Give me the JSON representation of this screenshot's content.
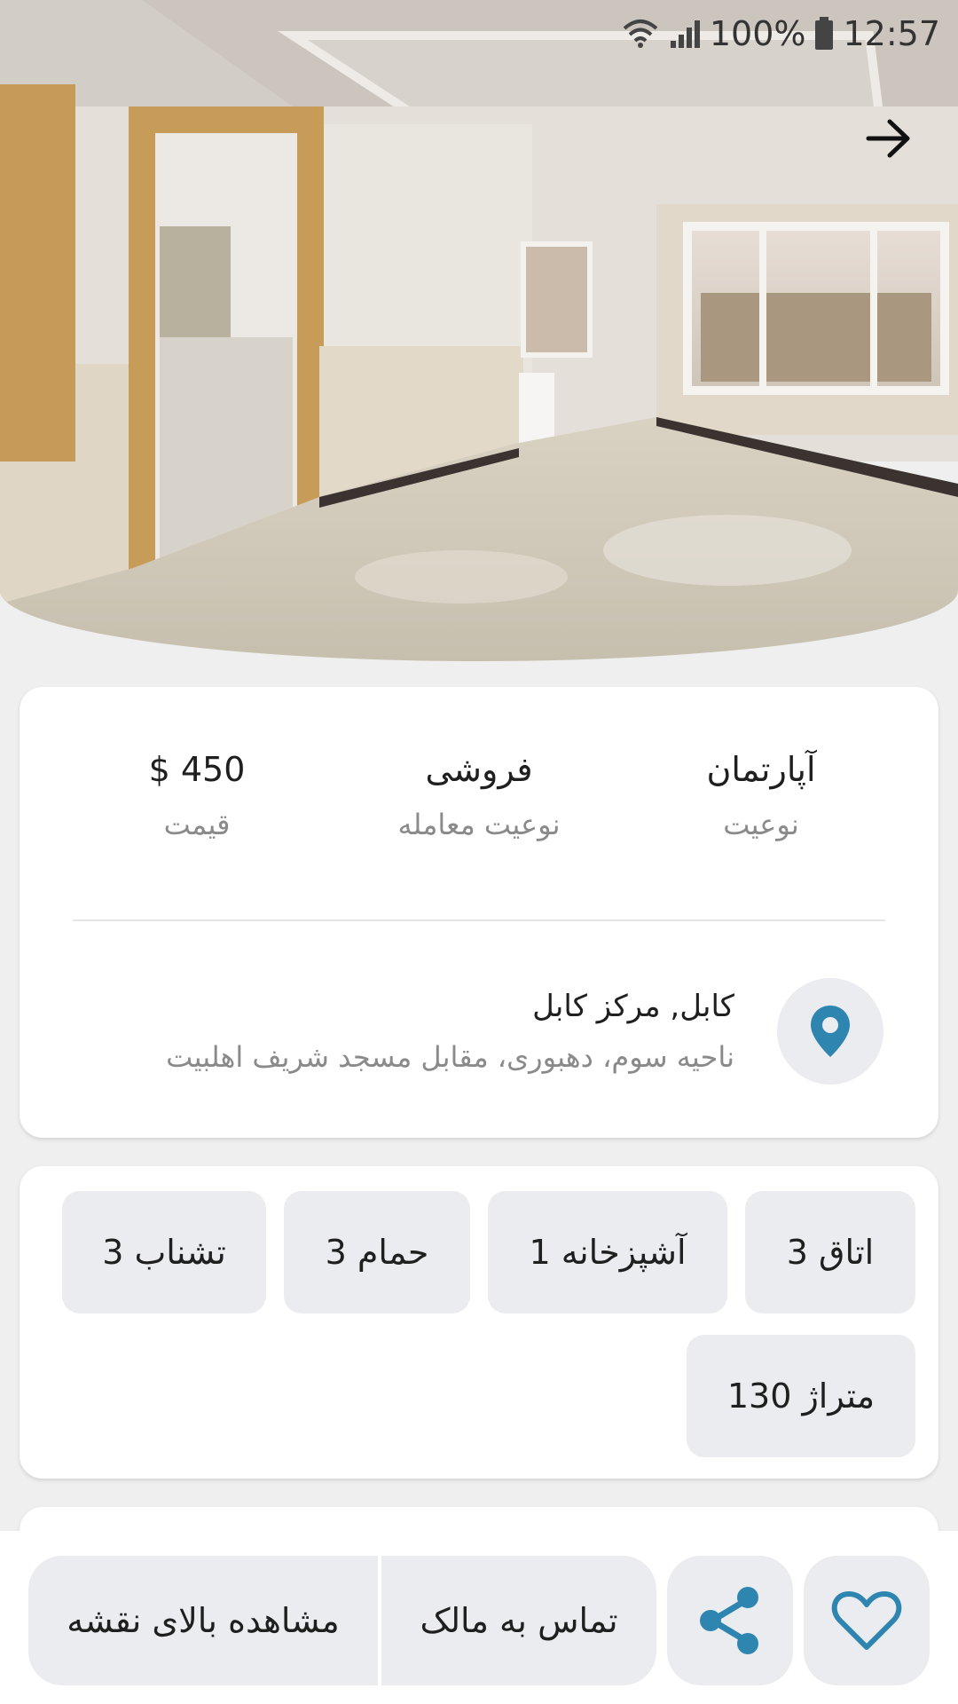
{
  "status_bar": {
    "battery": "100%",
    "time": "12:57",
    "icons": [
      "wifi-icon",
      "signal-icon",
      "battery-icon"
    ]
  },
  "header": {
    "back_icon": "arrow-right-icon",
    "photo": "apartment-interior-photo"
  },
  "summary": {
    "type_value": "آپارتمان",
    "type_label": "نوعیت",
    "deal_value": "فروشی",
    "deal_label": "نوعیت معامله",
    "price_value": "$ 450",
    "price_label": "قیمت"
  },
  "location": {
    "icon": "location-pin-icon",
    "title": "کابل, مرکز کابل",
    "address": "ناحیه سوم، دهبوری، مقابل مسجد شریف اهلبیت"
  },
  "features": [
    "اتاق 3",
    "آشپزخانه 1",
    "حمام 3",
    "تشناب 3",
    "متراژ 130"
  ],
  "actions": {
    "favorite_icon": "heart-icon",
    "share_icon": "share-icon",
    "contact_label": "تماس به مالک",
    "map_label": "مشاهده بالای نقشه"
  },
  "colors": {
    "accent": "#2e86b0",
    "chip_bg": "#ebecf0",
    "muted_text": "#8a8a8a"
  }
}
